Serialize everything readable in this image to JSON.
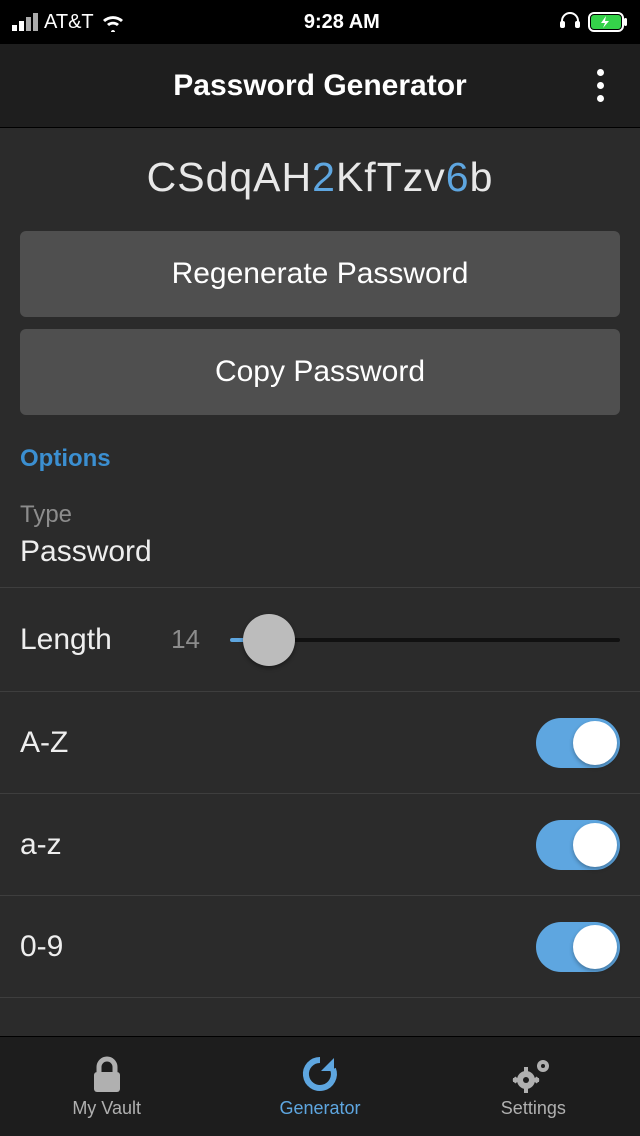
{
  "statusbar": {
    "carrier": "AT&T",
    "time": "9:28 AM"
  },
  "header": {
    "title": "Password Generator"
  },
  "password": {
    "segments": [
      {
        "text": "CSdqAH",
        "type": "alpha"
      },
      {
        "text": "2",
        "type": "digit"
      },
      {
        "text": "KfTzv",
        "type": "alpha"
      },
      {
        "text": "6",
        "type": "digit"
      },
      {
        "text": "b",
        "type": "alpha"
      }
    ]
  },
  "buttons": {
    "regenerate": "Regenerate Password",
    "copy": "Copy Password"
  },
  "options": {
    "heading": "Options",
    "type_label": "Type",
    "type_value": "Password",
    "length_label": "Length",
    "length_value": "14",
    "toggles": [
      {
        "label": "A-Z",
        "on": true
      },
      {
        "label": "a-z",
        "on": true
      },
      {
        "label": "0-9",
        "on": true
      }
    ]
  },
  "tabbar": {
    "items": [
      {
        "label": "My Vault"
      },
      {
        "label": "Generator"
      },
      {
        "label": "Settings"
      }
    ]
  }
}
